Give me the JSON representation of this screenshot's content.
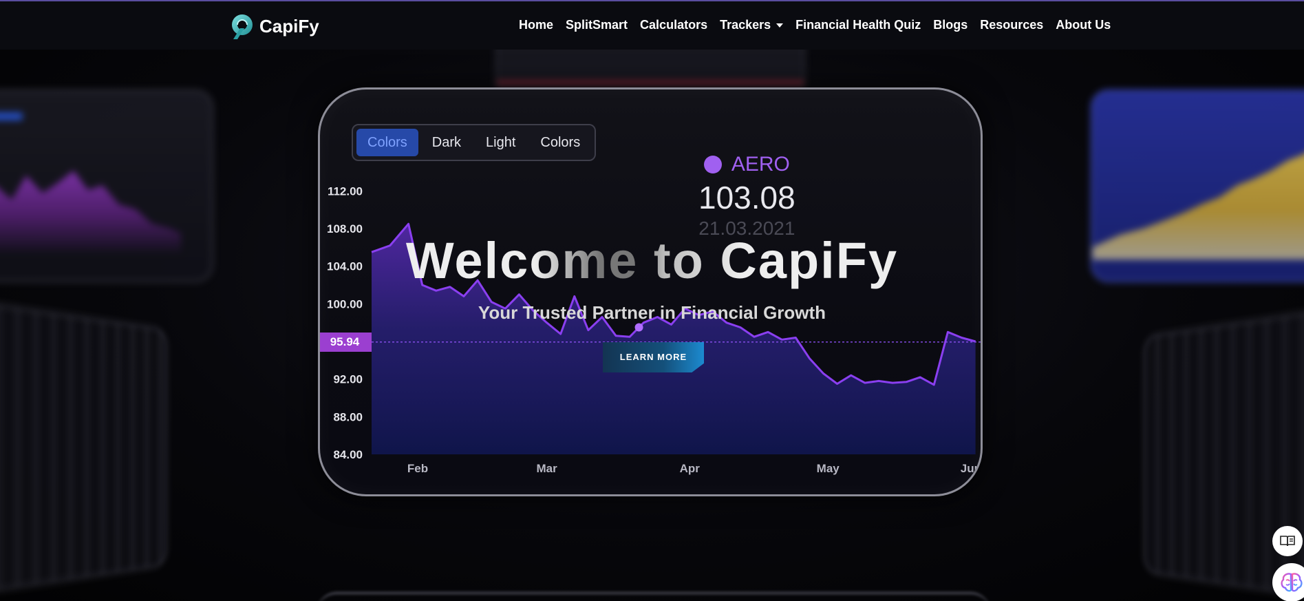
{
  "brand": {
    "name": "CapiFy",
    "logo_icon": "capify-logo-icon"
  },
  "nav": {
    "items": [
      {
        "label": "Home"
      },
      {
        "label": "SplitSmart"
      },
      {
        "label": "Calculators"
      },
      {
        "label": "Trackers",
        "dropdown": true
      },
      {
        "label": "Financial Health Quiz"
      },
      {
        "label": "Blogs"
      },
      {
        "label": "Resources"
      },
      {
        "label": "About Us"
      }
    ]
  },
  "hero": {
    "title": "Welcome to CapiFy",
    "subtitle": "Your Trusted Partner in Financial Growth",
    "cta_label": "LEARN MORE"
  },
  "chart_panel": {
    "tabs": [
      "Colors",
      "Dark",
      "Light",
      "Colors"
    ],
    "active_tab": 0,
    "ticker": {
      "name": "AERO",
      "value": "103.08",
      "date": "21.03.2021"
    },
    "current_value_label": "95.94"
  },
  "chart_data": {
    "type": "area",
    "x_ticks": [
      "Feb",
      "Mar",
      "Apr",
      "May",
      "Jun"
    ],
    "y_ticks": [
      "112.00",
      "108.00",
      "104.00",
      "100.00",
      "96.00",
      "92.00",
      "88.00",
      "84.00"
    ],
    "ylim": [
      84,
      114
    ],
    "current_value": 95.94,
    "series": [
      {
        "color": "#8a3ff0",
        "x": [
          "2021-01-22",
          "2021-01-26",
          "2021-01-30",
          "2021-02-02",
          "2021-02-05",
          "2021-02-08",
          "2021-02-11",
          "2021-02-14",
          "2021-02-17",
          "2021-02-20",
          "2021-02-23",
          "2021-02-26",
          "2021-03-01",
          "2021-03-04",
          "2021-03-07",
          "2021-03-10",
          "2021-03-13",
          "2021-03-16",
          "2021-03-19",
          "2021-03-22",
          "2021-03-25",
          "2021-03-28",
          "2021-03-31",
          "2021-04-03",
          "2021-04-06",
          "2021-04-09",
          "2021-04-12",
          "2021-04-15",
          "2021-04-18",
          "2021-04-21",
          "2021-04-24",
          "2021-04-27",
          "2021-04-30",
          "2021-05-03",
          "2021-05-06",
          "2021-05-09",
          "2021-05-12",
          "2021-05-15",
          "2021-05-18",
          "2021-05-21",
          "2021-05-24",
          "2021-05-27",
          "2021-05-30",
          "2021-06-02"
        ],
        "values": [
          105.5,
          106.2,
          108.5,
          102,
          101.4,
          101.8,
          100.8,
          102.5,
          100.2,
          99.5,
          101.0,
          99.3,
          98.0,
          96.8,
          100.8,
          97.2,
          98.6,
          96.6,
          96.5,
          98.0,
          98.6,
          97.8,
          99.5,
          98.8,
          99.2,
          98.0,
          97.5,
          96.5,
          97.0,
          96.2,
          96.4,
          94.2,
          92.6,
          91.5,
          92.4,
          91.6,
          91.8,
          91.6,
          91.7,
          92.2,
          91.4,
          97.0,
          96.4,
          96.0
        ]
      }
    ]
  },
  "colors": {
    "accent_purple": "#9b3fd0",
    "tab_active": "#2649a8",
    "cta_blue": "#1c8ad0"
  }
}
